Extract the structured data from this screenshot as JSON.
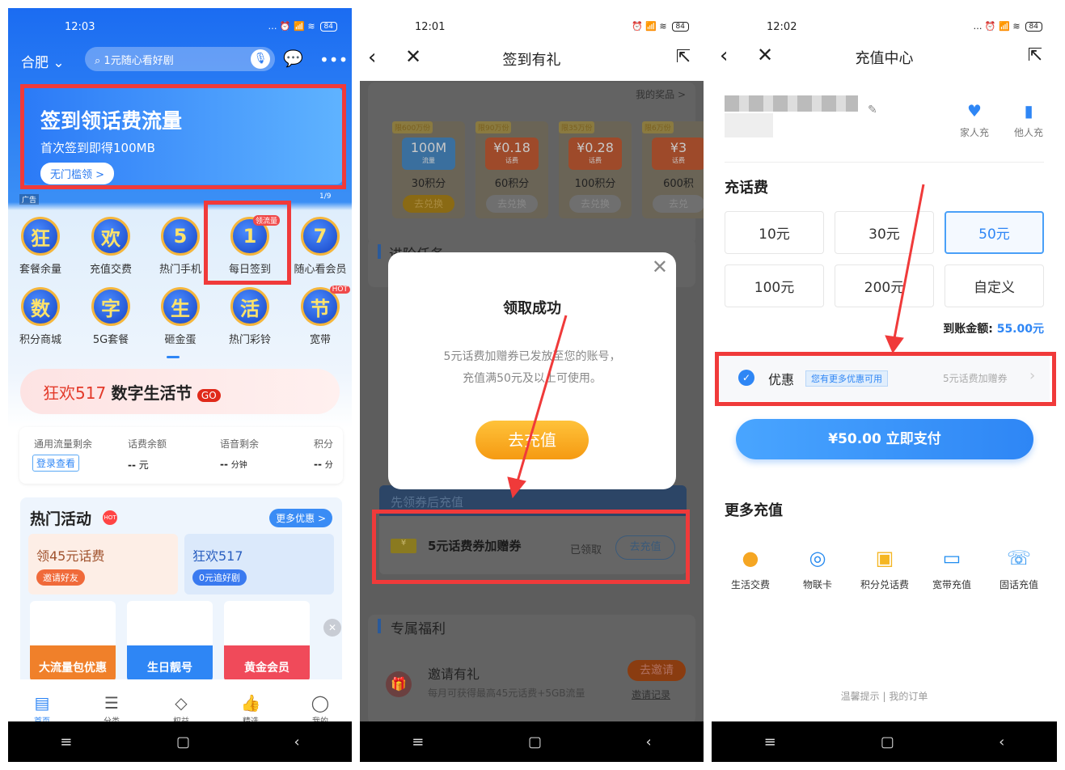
{
  "panel1": {
    "status": {
      "time": "12:03",
      "battery": "84"
    },
    "header": {
      "city": "合肥",
      "search_placeholder": "1元随心看好剧"
    },
    "banner": {
      "title": "签到领话费流量",
      "subtitle": "首次签到即得100MB",
      "button": "无门槛领 >",
      "ad_tag": "广告",
      "pager": "1/9"
    },
    "grid": [
      {
        "glyph": "狂",
        "label": "套餐余量"
      },
      {
        "glyph": "欢",
        "label": "充值交费"
      },
      {
        "glyph": "5",
        "label": "热门手机"
      },
      {
        "glyph": "1",
        "label": "每日签到",
        "badge": "领流量"
      },
      {
        "glyph": "7",
        "label": "随心看会员"
      },
      {
        "glyph": "数",
        "label": "积分商城"
      },
      {
        "glyph": "字",
        "label": "5G套餐"
      },
      {
        "glyph": "生",
        "label": "砸金蛋"
      },
      {
        "glyph": "活",
        "label": "热门彩铃"
      },
      {
        "glyph": "节",
        "label": "宽带",
        "badge": "HOT"
      }
    ],
    "promo": {
      "red": "狂欢517",
      "black": "数字生活节",
      "go": "GO"
    },
    "account": [
      {
        "label": "通用流量剩余",
        "value": "登录查看"
      },
      {
        "label": "话费余额",
        "value": "--",
        "unit": "元"
      },
      {
        "label": "语音剩余",
        "value": "--",
        "unit": "分钟"
      },
      {
        "label": "积分",
        "value": "--",
        "unit": "分"
      }
    ],
    "hot": {
      "title": "热门活动",
      "hot_badge": "HOT",
      "more": "更多优惠 >",
      "cards": [
        {
          "title": "领45元话费",
          "button": "邀请好友"
        },
        {
          "title": "狂欢517",
          "button": "0元追好剧"
        }
      ],
      "tiles": [
        "大流量包优惠",
        "生日靓号",
        "黄金会员"
      ]
    },
    "tabs": [
      {
        "label": "首页",
        "icon": "home-icon"
      },
      {
        "label": "分类",
        "icon": "category-icon"
      },
      {
        "label": "权益",
        "icon": "diamond-icon"
      },
      {
        "label": "精选",
        "icon": "thumbs-up-icon"
      },
      {
        "label": "我的",
        "icon": "user-icon"
      }
    ]
  },
  "panel2": {
    "status": {
      "time": "12:01",
      "battery": "84"
    },
    "title": "签到有礼",
    "my_prizes": "我的奖品 >",
    "prizes": [
      {
        "tag": "限600万份",
        "value": "100M",
        "sub": "流量",
        "points": "30积分",
        "button": "去兑换",
        "color": "#3a6f9e"
      },
      {
        "tag": "限90万份",
        "value": "¥0.18",
        "sub": "话费",
        "points": "60积分",
        "button": "去兑换",
        "color": "#9e4a2a"
      },
      {
        "tag": "限35万份",
        "value": "¥0.28",
        "sub": "话费",
        "points": "100积分",
        "button": "去兑换",
        "color": "#9e4a2a"
      },
      {
        "tag": "限6万份",
        "value": "¥3",
        "sub": "话费",
        "points": "600积",
        "button": "去兑",
        "color": "#9e4a2a"
      }
    ],
    "section_task": "进阶任务",
    "modal": {
      "title": "领取成功",
      "line1": "5元话费加赠券已发放至您的账号，",
      "line2": "充值满50元及以上可使用。",
      "button": "去充值"
    },
    "coupon_section": "先领券后充值",
    "coupon": {
      "name": "5元话费券加赠券",
      "status": "已领取",
      "button": "去充值"
    },
    "exclusive": "专属福利",
    "invite": {
      "title": "邀请有礼",
      "desc": "每月可获得最高45元话费+5GB流量",
      "button": "去邀请",
      "record": "邀请记录"
    }
  },
  "panel3": {
    "status": {
      "time": "12:02",
      "battery": "84"
    },
    "title": "充值中心",
    "quick": [
      {
        "label": "家人充"
      },
      {
        "label": "他人充"
      }
    ],
    "section": "充话费",
    "amounts": [
      "10元",
      "30元",
      "50元",
      "100元",
      "200元",
      "自定义"
    ],
    "selected": "50元",
    "arrival_label": "到账金额:",
    "arrival_value": "55.00元",
    "discount": {
      "label": "优惠",
      "tag": "您有更多优惠可用",
      "value": "5元话费加赠券"
    },
    "pay": "¥50.00 立即支付",
    "more_title": "更多充值",
    "more": [
      {
        "label": "生活交费",
        "glyph": "●",
        "color": "#f5a623"
      },
      {
        "label": "物联卡",
        "glyph": "◎",
        "color": "#2a8cf0"
      },
      {
        "label": "积分兑话费",
        "glyph": "▣",
        "color": "#f5b623"
      },
      {
        "label": "宽带充值",
        "glyph": "▭",
        "color": "#1f8cf0"
      },
      {
        "label": "固话充值",
        "glyph": "☏",
        "color": "#1f8cf0"
      }
    ],
    "footer": {
      "tips": "温馨提示",
      "sep": "|",
      "orders": "我的订单"
    }
  },
  "colors": {
    "accent_blue": "#2e86f5",
    "highlight_red": "#f03a3a",
    "orange": "#f5a21c"
  }
}
